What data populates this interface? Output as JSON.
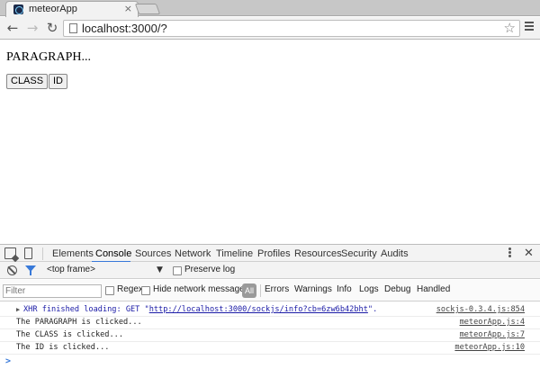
{
  "browser": {
    "tab_title": "meteorApp",
    "tab_close": "×",
    "url": "localhost:3000/?",
    "icons": [
      "back-icon",
      "forward-icon",
      "reload-icon",
      "star-icon",
      "menu-icon"
    ]
  },
  "page": {
    "paragraph": "PARAGRAPH...",
    "class_button": "CLASS",
    "id_button": "ID"
  },
  "devtools": {
    "tabs": [
      "Elements",
      "Console",
      "Sources",
      "Network",
      "Timeline",
      "Profiles",
      "Resources",
      "Security",
      "Audits"
    ],
    "active_tab": "Console",
    "frame": "<top frame>",
    "preserve_log": "Preserve log",
    "filter_placeholder": "Filter",
    "regex": "Regex",
    "hide_network": "Hide network messages",
    "all": "All",
    "levels": [
      "Errors",
      "Warnings",
      "Info",
      "Logs",
      "Debug",
      "Handled"
    ],
    "accent": "#3879d9",
    "logs": [
      {
        "prefix": "XHR finished loading: GET \"",
        "url": "http://localhost:3000/sockjs/info?cb=6zw6b42bht",
        "suffix": "\".",
        "source": "sockjs-0.3.4.js:854"
      },
      {
        "message": "The PARAGRAPH is clicked...",
        "source": "meteorApp.js:4"
      },
      {
        "message": "The CLASS is clicked...",
        "source": "meteorApp.js:7"
      },
      {
        "message": "The ID is clicked...",
        "source": "meteorApp.js:10"
      }
    ],
    "prompt": ">"
  }
}
